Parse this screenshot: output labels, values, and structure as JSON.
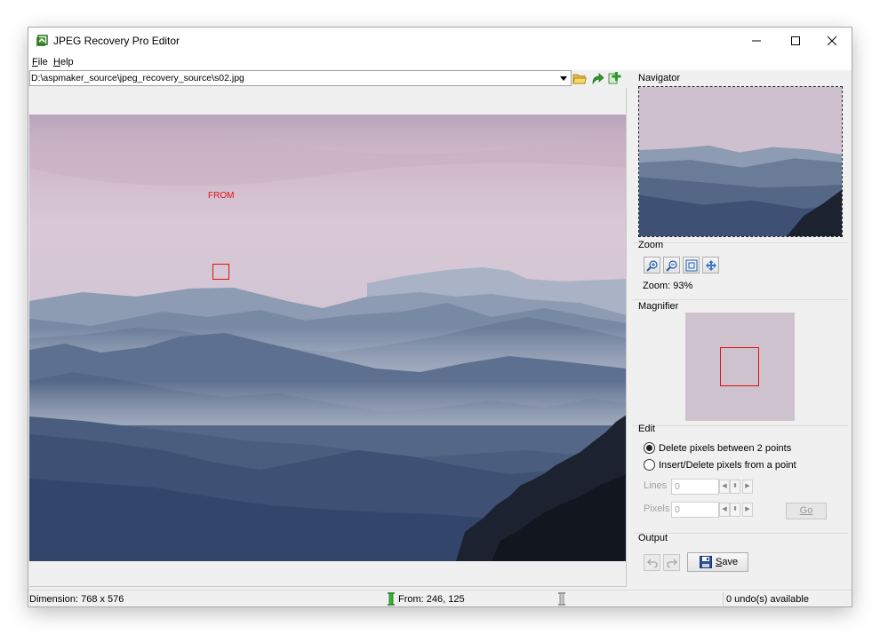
{
  "window": {
    "title": "JPEG Recovery Pro Editor"
  },
  "menu": {
    "file": "File",
    "help": "Help"
  },
  "path_bar": {
    "path": "D:\\aspmaker_source\\jpeg_recovery_source\\s02.jpg"
  },
  "image": {
    "marker_label": "FROM"
  },
  "navigator": {
    "title": "Navigator"
  },
  "zoom": {
    "title": "Zoom",
    "value_text": "Zoom: 93%"
  },
  "magnifier": {
    "title": "Magnifier"
  },
  "edit": {
    "title": "Edit",
    "option_delete": "Delete pixels between 2 points",
    "option_insert": "Insert/Delete pixels from a point",
    "lines_label": "Lines",
    "lines_value": "0",
    "pixels_label": "Pixels",
    "pixels_value": "0",
    "go_label": "Go"
  },
  "output": {
    "title": "Output",
    "save_label": "Save"
  },
  "status": {
    "dimension": "Dimension: 768 x 576",
    "from": "From: 246, 125",
    "undo": "0 undo(s) available"
  },
  "colors": {
    "marker_red": "#e01010",
    "sky_pink": "#d6c3d2",
    "mountain_blue": "#3f5675"
  }
}
